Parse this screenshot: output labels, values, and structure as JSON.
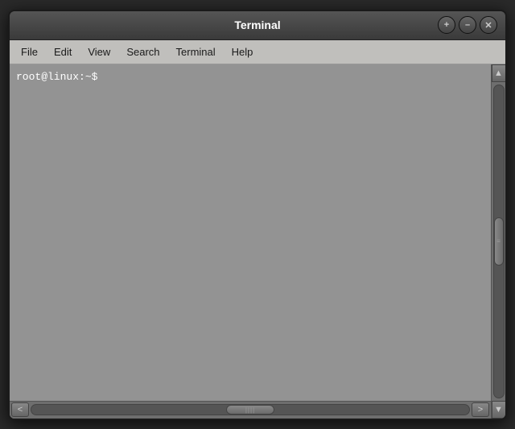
{
  "titleBar": {
    "title": "Terminal",
    "controls": {
      "add": "+",
      "minimize": "–",
      "close": "✕"
    }
  },
  "menuBar": {
    "items": [
      "File",
      "Edit",
      "View",
      "Search",
      "Terminal",
      "Help"
    ]
  },
  "terminal": {
    "prompt": "root@linux:~$"
  },
  "scrollbar": {
    "leftArrow": "<",
    "rightArrow": ">",
    "upArrow": "▲",
    "downArrow": "▼",
    "hThumb": "||||",
    "vThumb": "≡"
  }
}
